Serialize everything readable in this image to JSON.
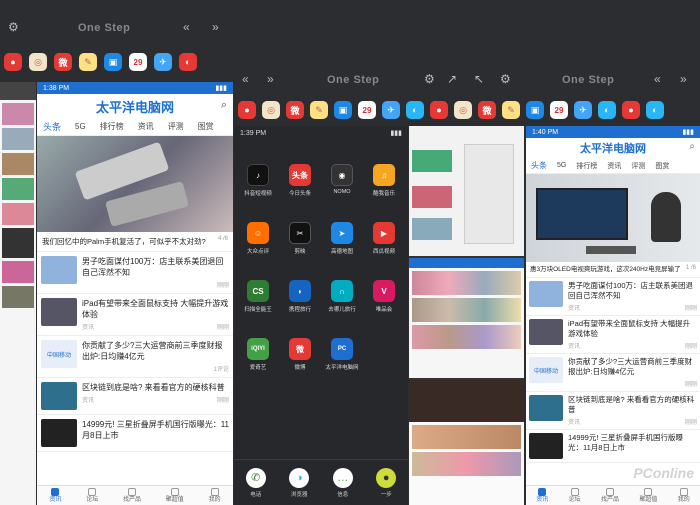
{
  "top_left_bar": {
    "title": "One Step"
  },
  "top_right_bar": {
    "title": "One Step"
  },
  "dock_apps": [
    "weibo-icon",
    "search-icon",
    "note-icon",
    "photo-icon",
    "calendar-icon",
    "mail-icon",
    "vpn-icon"
  ],
  "calendar_day": "29",
  "left_phone": {
    "time": "1:38 PM",
    "brand": "太平洋电脑网",
    "tabs": [
      "头条",
      "5G",
      "排行榜",
      "资讯",
      "评测",
      "图赏"
    ],
    "hero": {
      "caption": "我们回忆中的Palm手机复活了，可似乎不太对劲?",
      "counter": "4 /6"
    },
    "news": [
      {
        "title": "男子吃面谋付100万：店主联系美团退回自己浑然不知",
        "source": "",
        "meta": "刚刚"
      },
      {
        "title": "iPad有望带来全面鼠标支持 大幅提升游戏体验",
        "source": "资讯",
        "meta": "刚刚"
      },
      {
        "title": "你贡献了多少?三大运营商前三季度财报出炉:日均赚4亿元",
        "source": "",
        "meta": "1评论"
      },
      {
        "title": "区块链到底是啥? 来看看官方的硬核科普",
        "source": "资讯",
        "meta": "刚刚"
      },
      {
        "title": "14999元! 三星折叠屏手机国行版曝光：11月8日上市",
        "source": "",
        "meta": ""
      }
    ],
    "nav": [
      "资讯",
      "论坛",
      "找产品",
      "聚超值",
      "我的"
    ]
  },
  "middle_phone": {
    "time": "1:39 PM",
    "apps": [
      {
        "label": "抖音短视频",
        "color": "#111"
      },
      {
        "label": "今日头条",
        "color": "#e53935",
        "text": "头条"
      },
      {
        "label": "NOMO",
        "color": "#333"
      },
      {
        "label": "酷我音乐",
        "color": "#f5a623"
      },
      {
        "label": "大众点评",
        "color": "#ff6f00"
      },
      {
        "label": "剪映",
        "color": "#111"
      },
      {
        "label": "高德地图",
        "color": "#1e88e5"
      },
      {
        "label": "西瓜视频",
        "color": "#e53935"
      },
      {
        "label": "扫描全能王",
        "color": "#2e7d32",
        "text": "CS"
      },
      {
        "label": "携程旅行",
        "color": "#1565c0"
      },
      {
        "label": "去哪儿旅行",
        "color": "#00acc1"
      },
      {
        "label": "唯品会",
        "color": "#d81b60"
      },
      {
        "label": "爱奇艺",
        "color": "#43a047",
        "text": "iQIYI"
      },
      {
        "label": "微博",
        "color": "#e53935"
      },
      {
        "label": "太平洋电脑网",
        "color": "#1f6fd1"
      }
    ],
    "dock_labels": [
      "电话",
      "浏览器",
      "信息",
      "一步"
    ]
  },
  "right_phone": {
    "time": "1:40 PM",
    "brand": "太平洋电脑网",
    "tabs": [
      "头条",
      "5G",
      "排行榜",
      "资讯",
      "评测",
      "图赏"
    ],
    "hero": {
      "caption": "惠3万块OLED电视爽玩游戏，这次240Hz电竞屏输了",
      "counter": "1 /6"
    },
    "news": [
      {
        "title": "男子吃面谋付100万：店主联系美团退回自己浑然不知",
        "source": "资讯",
        "meta": "刚刚"
      },
      {
        "title": "iPad有望带来全面鼠标支持 大幅提升游戏体验",
        "source": "资讯",
        "meta": "刚刚"
      },
      {
        "title": "你贡献了多少?三大运营商前三季度财报出炉:日均赚4亿元",
        "source": "",
        "meta": "刚刚"
      },
      {
        "title": "区块链到底是啥? 来看看官方的硬核科普",
        "source": "资讯",
        "meta": "刚刚"
      },
      {
        "title": "14999元! 三星折叠屏手机国行版曝光：11月8日上市",
        "source": "",
        "meta": ""
      }
    ],
    "nav": [
      "资讯",
      "论坛",
      "找产品",
      "聚超值",
      "我的"
    ]
  },
  "watermark": "PConline"
}
